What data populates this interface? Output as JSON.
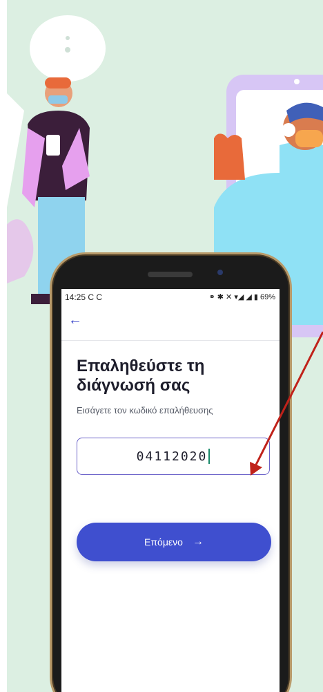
{
  "status_bar": {
    "time": "14:25",
    "sync_icons": "C C",
    "right_text": "⚭ ✱ ✕ ▾◢ ◢ ▮ 69%"
  },
  "app_bar": {
    "back_icon": "arrow-left"
  },
  "screen": {
    "title": "Επαληθεύστε τη διάγνωσή σας",
    "subtitle": "Εισάγετε τον κωδικό επαλήθευσης",
    "code_value": "04112020",
    "next_label": "Επόμενο",
    "next_arrow": "→"
  },
  "colors": {
    "accent": "#3f4fcf",
    "background": "#dcefe2",
    "annotation_arrow": "#c0221a"
  }
}
